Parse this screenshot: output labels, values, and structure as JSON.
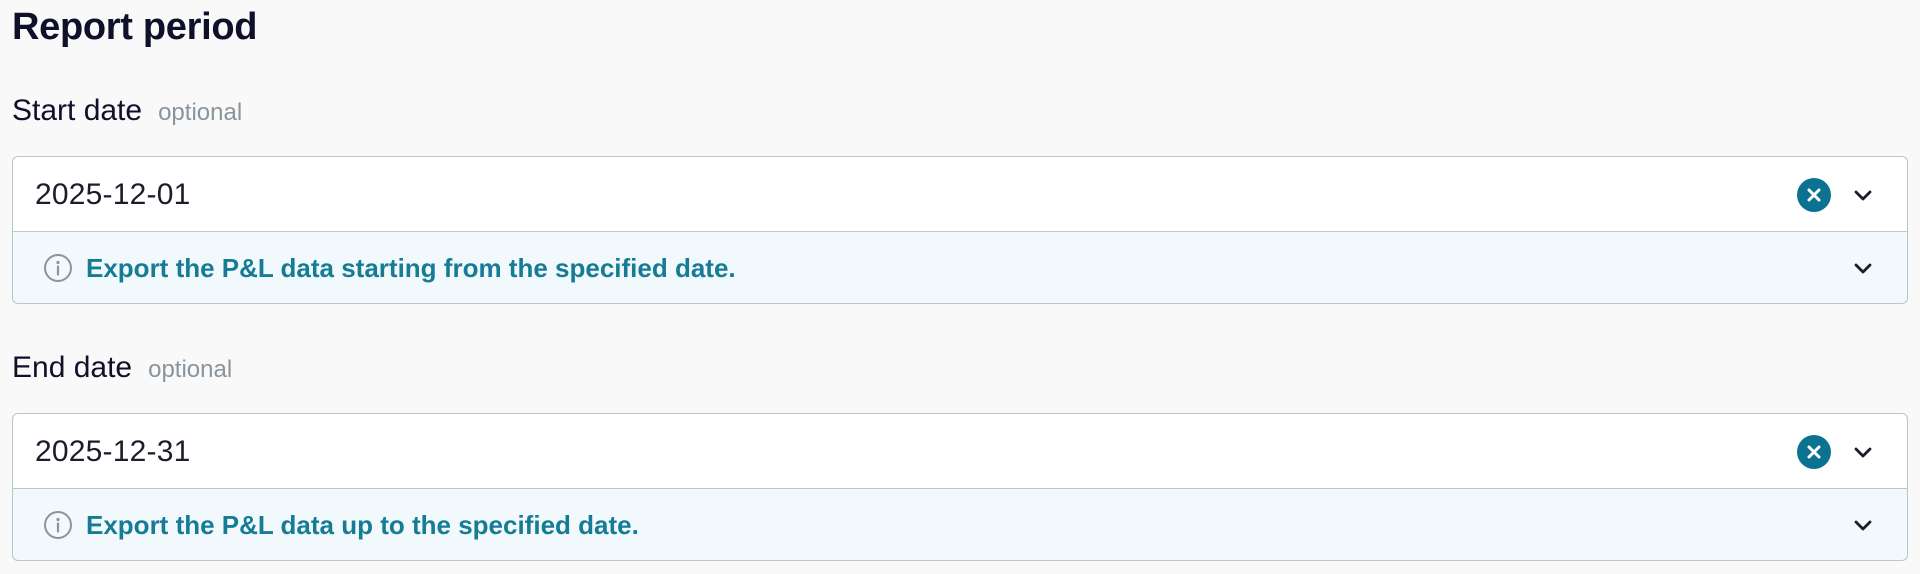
{
  "section": {
    "title": "Report period"
  },
  "fields": [
    {
      "label": "Start date",
      "optional": "optional",
      "value": "2025-12-01",
      "hint": "Export the P&L data starting from the specified date."
    },
    {
      "label": "End date",
      "optional": "optional",
      "value": "2025-12-31",
      "hint": "Export the P&L data up to the specified date."
    }
  ],
  "icons": {
    "clear": "clear-circle-icon",
    "dropdown": "chevron-down-icon",
    "info": "info-icon"
  },
  "colors": {
    "accent": "#0b7391",
    "hint_text": "#167c96",
    "hint_background": "#f1f9fc",
    "border": "#b9c6cc",
    "muted": "#8a949c"
  }
}
